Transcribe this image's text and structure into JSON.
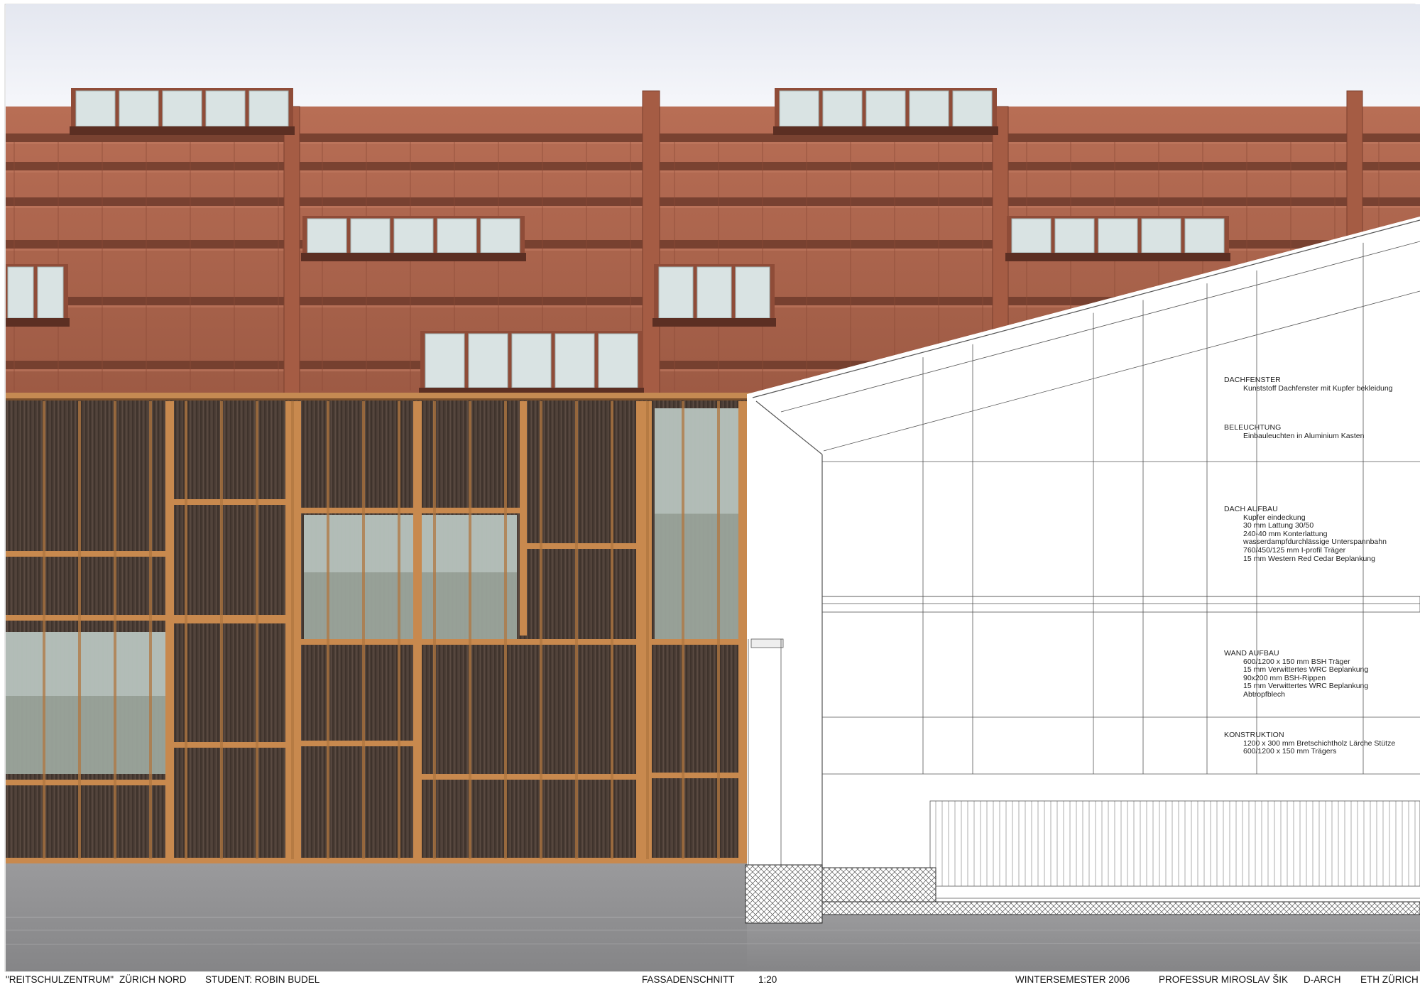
{
  "sheet": {
    "notes": [
      {
        "heading": "DACHFENSTER",
        "lines": [
          "Kunststoff Dachfenster mit Kupfer bekleidung"
        ]
      },
      {
        "heading": "BELEUCHTUNG",
        "lines": [
          "Einbauleuchten in Aluminium Kasten"
        ]
      },
      {
        "heading": "DACH AUFBAU",
        "lines": [
          "Kupfer eindeckung",
          "30 mm Lattung 30/50",
          "240-40 mm Konterlattung",
          "wasserdampfdurchlässige Unterspannbahn",
          "760/450/125 mm I-profil Träger",
          "15 mm Western Red Cedar Beplankung"
        ]
      },
      {
        "heading": "WAND AUFBAU",
        "lines": [
          "600/1200 x 150 mm BSH Träger",
          "15 mm  Verwittertes WRC Beplankung",
          "90x200 mm BSH-Rippen",
          "15 mm  Verwittertes WRC Beplankung",
          "Abtropfblech"
        ]
      },
      {
        "heading": "KONSTRUKTION",
        "lines": [
          "1200 x 300 mm Bretschichtholz Lärche Stütze",
          "600/1200  x 150 mm Trägers"
        ]
      }
    ],
    "titleblock": {
      "project": "\"REITSCHULZENTRUM\"",
      "location": "ZÜRICH NORD",
      "student": "STUDENT:  ROBIN BUDEL",
      "drawing": "FASSADENSCHNITT",
      "scale": "1:20",
      "semester": "WINTERSEMESTER 2006",
      "professor": "PROFESSUR MIROSLAV ŠIK",
      "department": "D-ARCH",
      "school": "ETH ZÜRICH"
    }
  },
  "colors": {
    "sky": "#eef0f6",
    "roof_copper": "#a8604a",
    "roof_shadow": "#6d3a2b",
    "timber": "#c8894e",
    "wall_cladding": "#4a3d36",
    "glass": "#d8e2e2",
    "ground": "#8a8a8c",
    "line": "#444444"
  }
}
